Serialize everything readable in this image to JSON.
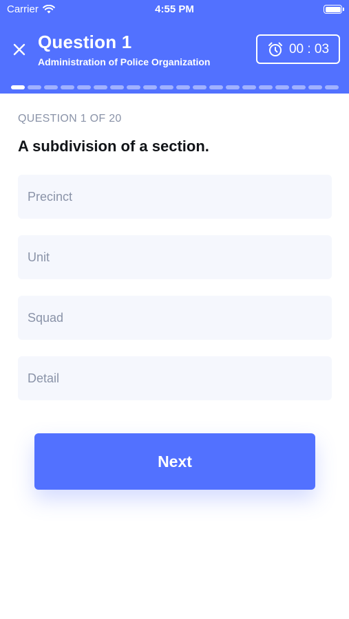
{
  "status_bar": {
    "carrier": "Carrier",
    "time": "4:55 PM",
    "wifi_icon": "wifi-icon",
    "battery_icon": "battery-icon"
  },
  "header": {
    "title": "Question 1",
    "subtitle": "Administration of Police Organization",
    "timer": "00 : 03",
    "close_icon": "close-icon",
    "timer_icon": "alarm-clock-icon",
    "background_color": "#5271ff"
  },
  "progress": {
    "current": 1,
    "total": 20
  },
  "question": {
    "counter": "QUESTION 1 OF 20",
    "text": "A subdivision of a section."
  },
  "options": [
    {
      "label": "Precinct"
    },
    {
      "label": "Unit"
    },
    {
      "label": "Squad"
    },
    {
      "label": "Detail"
    }
  ],
  "next_button": {
    "label": "Next",
    "color": "#5271ff"
  }
}
